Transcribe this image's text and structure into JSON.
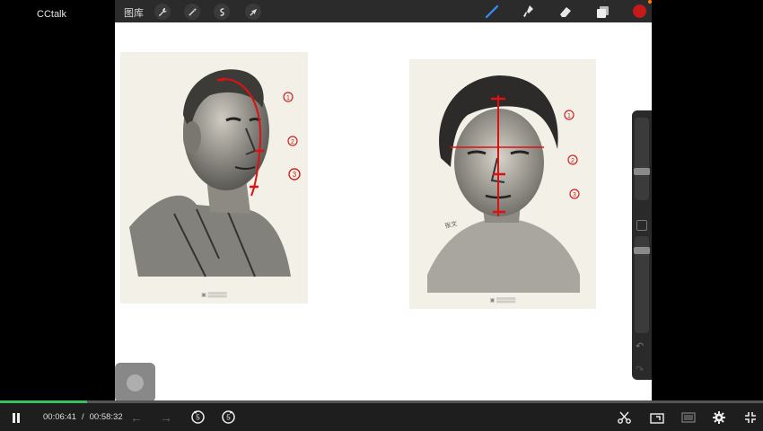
{
  "app": {
    "title": "CCtalk"
  },
  "canvas_toolbar": {
    "gallery_label": "图库",
    "tools_left": [
      "wrench-icon",
      "magic-wand-icon",
      "selection-icon",
      "transform-arrow-icon"
    ],
    "tools_right": [
      "brush-icon",
      "smudge-icon",
      "eraser-icon",
      "layers-icon"
    ],
    "active_color": "#c51a1a"
  },
  "sketches": {
    "left": {
      "annotations": [
        "1",
        "2",
        "3"
      ]
    },
    "right": {
      "annotations": [
        "1",
        "2",
        "3"
      ],
      "signature": "张文"
    }
  },
  "player": {
    "current_time": "00:06:41",
    "separator": "/",
    "total_time": "00:58:32",
    "progress": 0.114,
    "rewind_label": "5",
    "forward_label": "5",
    "accent_color": "#35c45b"
  }
}
